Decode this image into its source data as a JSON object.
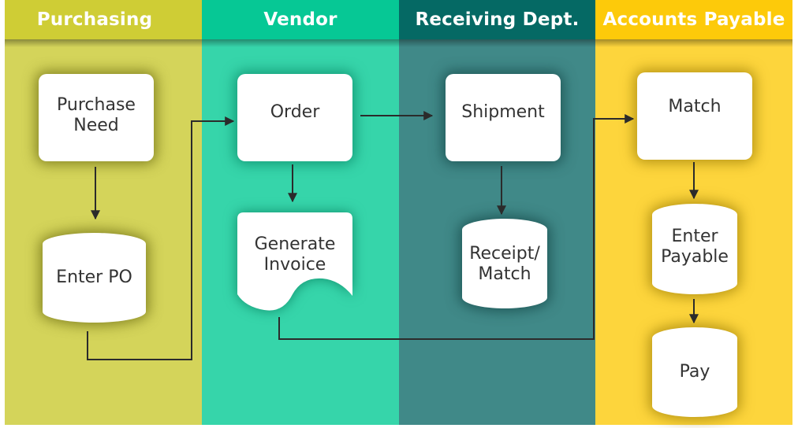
{
  "diagram": {
    "type": "swimlane-flowchart",
    "lanes": [
      {
        "id": "purchasing",
        "label": "Purchasing",
        "head_color": "#cfcd35",
        "body_color": "#d4d45a"
      },
      {
        "id": "vendor",
        "label": "Vendor",
        "head_color": "#06c895",
        "body_color": "#36d5aa"
      },
      {
        "id": "receiving",
        "label": "Receiving Dept.",
        "head_color": "#056964",
        "body_color": "#408988"
      },
      {
        "id": "accounts-payable",
        "label": "Accounts Payable",
        "head_color": "#fdca0a",
        "body_color": "#fdd53c"
      }
    ],
    "nodes": {
      "purchase_need": {
        "label_line1": "Purchase",
        "label_line2": "Need",
        "shape": "rounded-rect",
        "lane": "purchasing"
      },
      "enter_po": {
        "label": "Enter PO",
        "shape": "cylinder",
        "lane": "purchasing"
      },
      "order": {
        "label": "Order",
        "shape": "rounded-rect",
        "lane": "vendor"
      },
      "generate_invoice": {
        "label_line1": "Generate",
        "label_line2": "Invoice",
        "shape": "document",
        "lane": "vendor"
      },
      "shipment": {
        "label": "Shipment",
        "shape": "rounded-rect",
        "lane": "receiving"
      },
      "receipt_match": {
        "label_line1": "Receipt/",
        "label_line2": "Match",
        "shape": "cylinder",
        "lane": "receiving"
      },
      "match": {
        "label": "Match",
        "shape": "rounded-rect",
        "lane": "accounts-payable"
      },
      "enter_payable": {
        "label_line1": "Enter",
        "label_line2": "Payable",
        "shape": "cylinder",
        "lane": "accounts-payable"
      },
      "pay": {
        "label": "Pay",
        "shape": "cylinder",
        "lane": "accounts-payable"
      }
    },
    "edges": [
      {
        "from": "Purchase Need",
        "to": "Enter PO"
      },
      {
        "from": "Enter PO",
        "to": "Order"
      },
      {
        "from": "Order",
        "to": "Generate Invoice"
      },
      {
        "from": "Order",
        "to": "Shipment"
      },
      {
        "from": "Shipment",
        "to": "Receipt/Match"
      },
      {
        "from": "Generate Invoice",
        "to": "Match"
      },
      {
        "from": "Match",
        "to": "Enter Payable"
      },
      {
        "from": "Enter Payable",
        "to": "Pay"
      }
    ],
    "edge_color": "#2b2b2b"
  }
}
